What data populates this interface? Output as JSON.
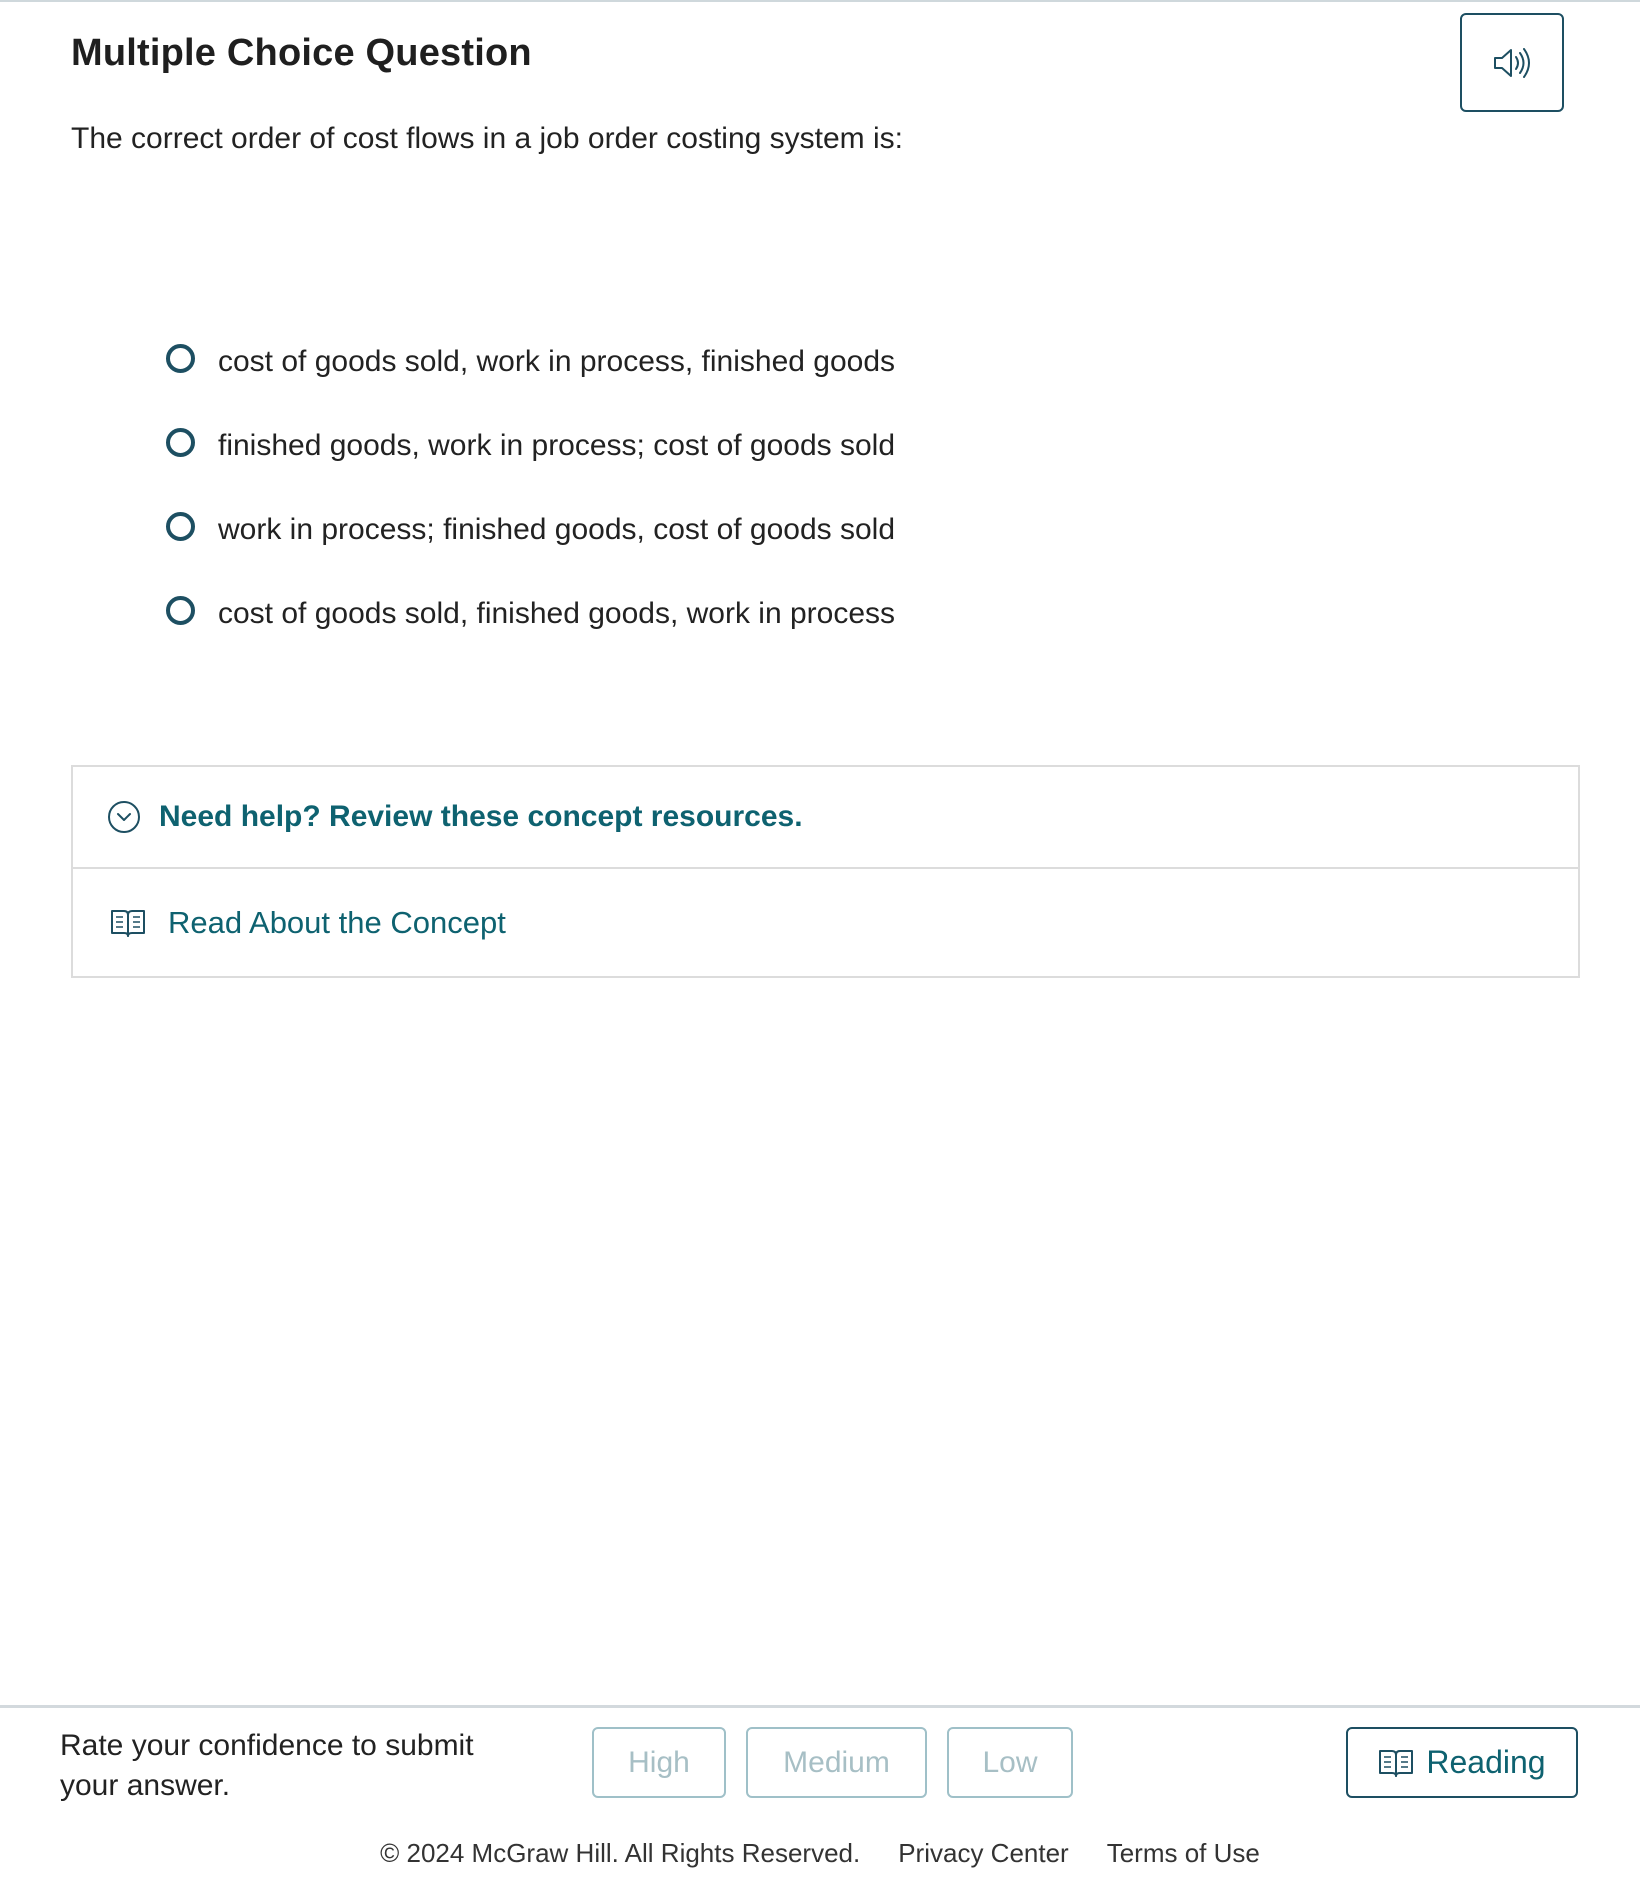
{
  "question": {
    "type_title": "Multiple Choice Question",
    "stem": "The correct order of cost flows in a job order costing system is:",
    "options": [
      {
        "label": "cost of goods sold, work in process, finished goods"
      },
      {
        "label": "finished goods, work in process; cost of goods sold"
      },
      {
        "label": "work in process; finished goods, cost of goods sold"
      },
      {
        "label": "cost of goods sold, finished goods, work in process"
      }
    ]
  },
  "audio": {
    "icon": "speaker-icon"
  },
  "help": {
    "title": "Need help? Review these concept resources.",
    "link_label": "Read About the Concept"
  },
  "confidence": {
    "label": "Rate your confidence to submit your answer.",
    "buttons": {
      "high": "High",
      "medium": "Medium",
      "low": "Low"
    }
  },
  "reading_button": {
    "label": "Reading"
  },
  "footer": {
    "copyright": "© 2024 McGraw Hill. All Rights Reserved.",
    "privacy": "Privacy Center",
    "terms": "Terms of Use"
  },
  "colors": {
    "accent": "#0e6270",
    "border_dark": "#1d4f62",
    "disabled": "#a7bfc5"
  }
}
